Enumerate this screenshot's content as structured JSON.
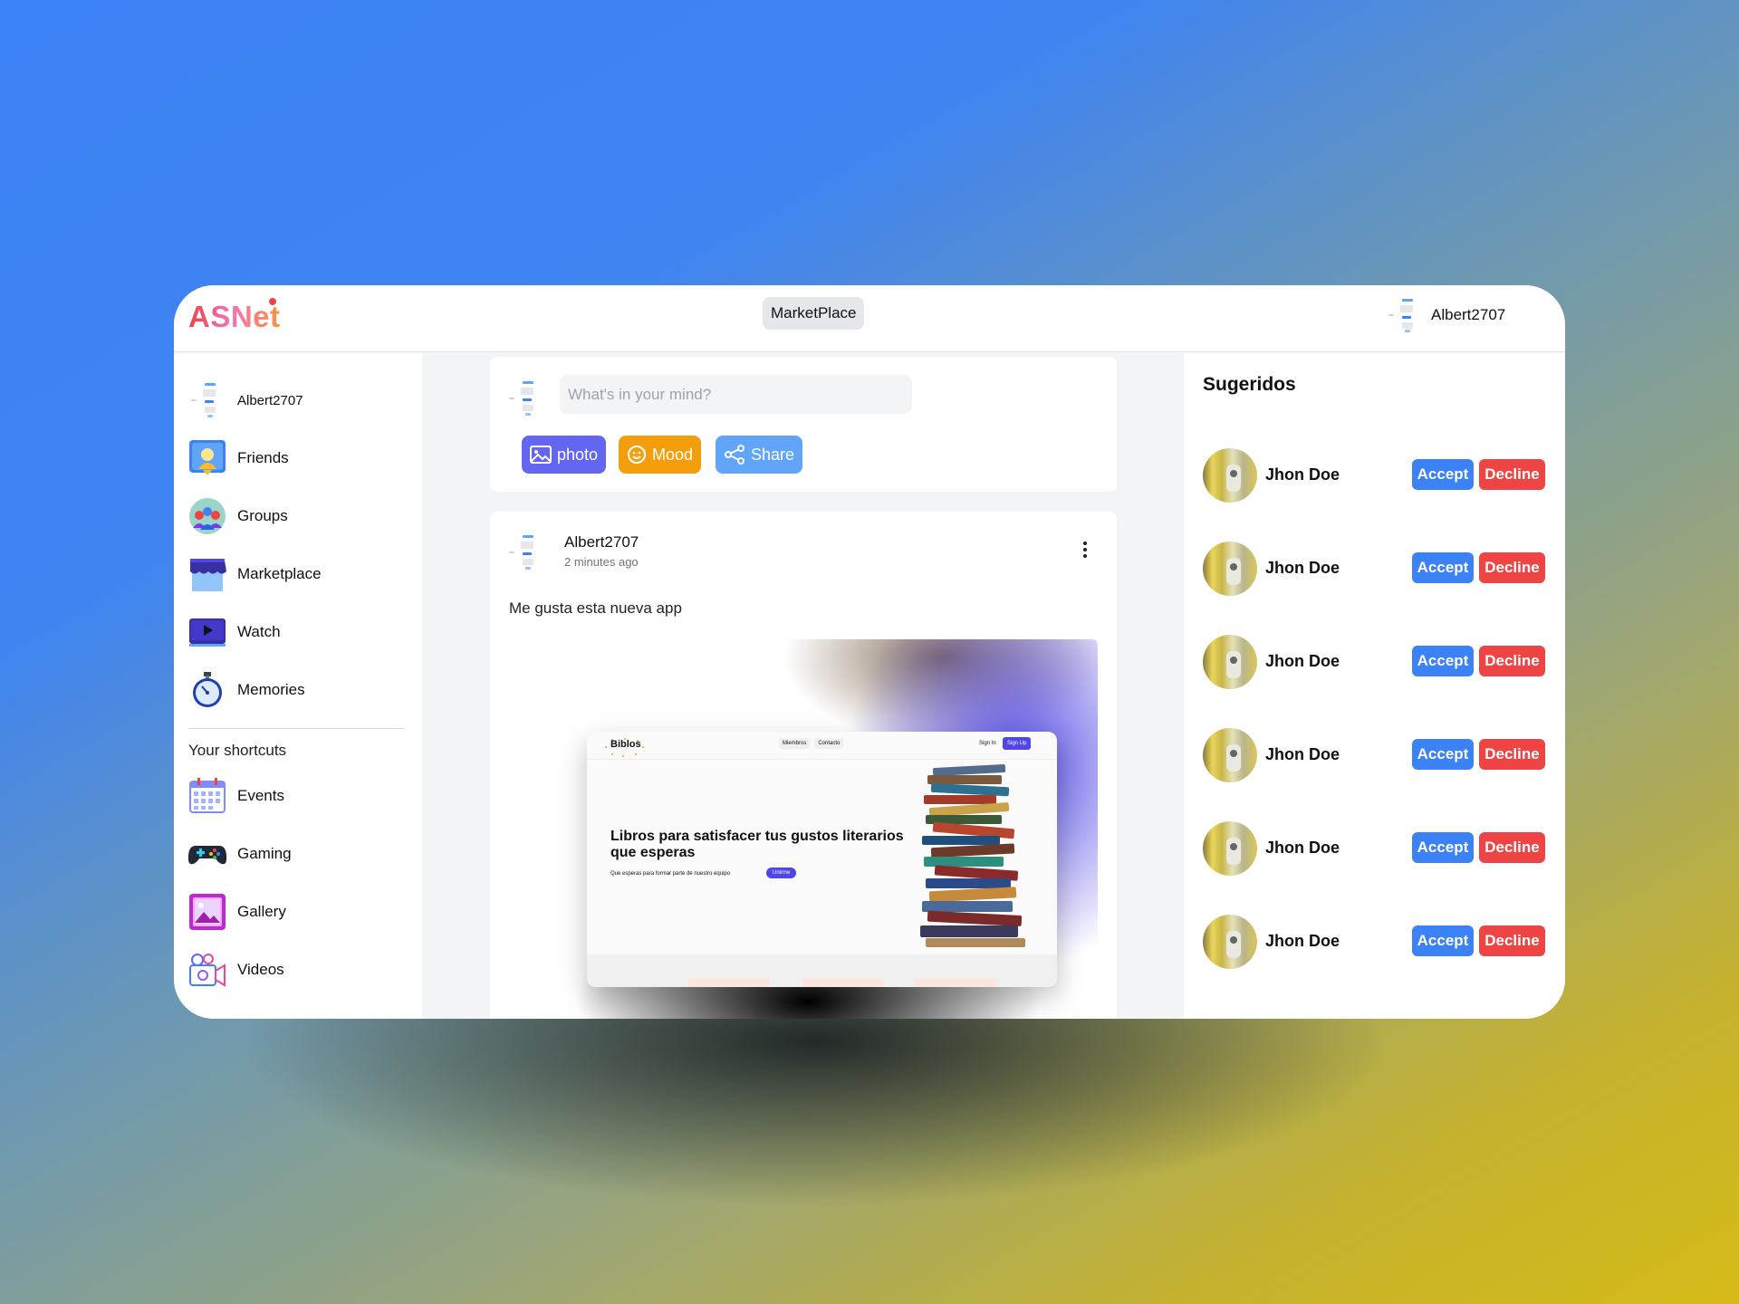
{
  "app": {
    "brand": "ASNet",
    "nav_link": "MarketPlace",
    "current_user": "Albert2707"
  },
  "sidebar": {
    "user": "Albert2707",
    "items": [
      {
        "label": "Friends",
        "icon": "friends-icon"
      },
      {
        "label": "Groups",
        "icon": "groups-icon"
      },
      {
        "label": "Marketplace",
        "icon": "marketplace-icon"
      },
      {
        "label": "Watch",
        "icon": "watch-icon"
      },
      {
        "label": "Memories",
        "icon": "memories-icon"
      }
    ],
    "shortcuts_title": "Your shortcuts",
    "shortcuts": [
      {
        "label": "Events",
        "icon": "calendar-icon"
      },
      {
        "label": "Gaming",
        "icon": "gamepad-icon"
      },
      {
        "label": "Gallery",
        "icon": "gallery-icon"
      },
      {
        "label": "Videos",
        "icon": "video-camera-icon"
      }
    ]
  },
  "composer": {
    "placeholder": "What's in your mind?",
    "buttons": {
      "photo": "photo",
      "mood": "Mood",
      "share": "Share"
    },
    "colors": {
      "photo": "#6366f1",
      "mood": "#f59e0b",
      "share": "#60a5fa"
    }
  },
  "post": {
    "author": "Albert2707",
    "time": "2 minutes ago",
    "text": "Me gusta esta nueva app",
    "media": {
      "brand": "Biblos",
      "nav": [
        "Miembros",
        "Contacto"
      ],
      "sign_in": "Sign In",
      "sign_up": "Sign Up",
      "headline": "Libros para satisfacer tus gustos literarios que esperas",
      "subtext": "Que esperas para formar parte de nuestro equipo",
      "cta": "Unirme"
    }
  },
  "suggestions": {
    "title": "Sugeridos",
    "accept_label": "Accept",
    "decline_label": "Decline",
    "people": [
      "Jhon Doe",
      "Jhon Doe",
      "Jhon Doe",
      "Jhon Doe",
      "Jhon Doe",
      "Jhon Doe"
    ],
    "colors": {
      "accept": "#3b82f6",
      "decline": "#ef4444"
    }
  }
}
